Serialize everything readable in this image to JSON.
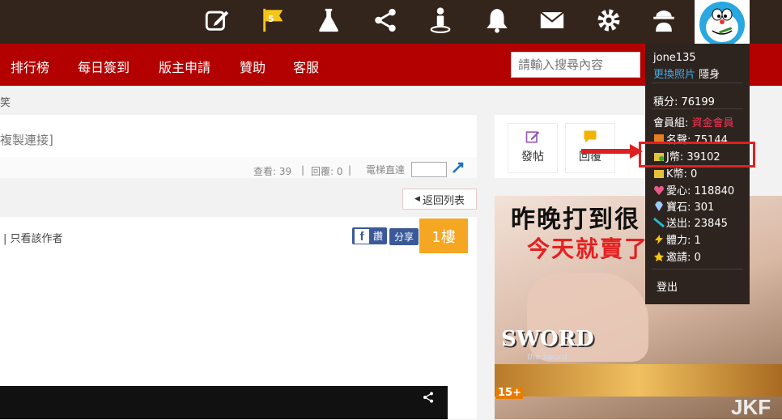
{
  "topbar": {
    "flag_count": "5",
    "icons": [
      "edit-icon",
      "flag-icon",
      "flask-icon",
      "share-icon",
      "user-location-icon",
      "bell-icon",
      "mail-icon",
      "gear-icon",
      "spy-icon"
    ]
  },
  "nav": {
    "items": [
      "排行榜",
      "每日簽到",
      "版主申請",
      "贊助",
      "客服"
    ]
  },
  "search": {
    "placeholder": "請輸入搜尋內容"
  },
  "breadcrumb": "笑",
  "thread": {
    "copy_link": "複製連接]",
    "views_label": "查看: 39",
    "replies_label": "回覆: 0",
    "elevator_label": "電梯直達",
    "back_to_list": "返回列表",
    "only_author": "| 只看該作者",
    "like_btn": "讚",
    "share_btn": "分享",
    "floor": "1樓"
  },
  "right_buttons": {
    "post": "發帖",
    "reply": "回覆"
  },
  "user_menu": {
    "username": "jone135",
    "change_photo": "更換照片",
    "invisible": "隱身",
    "points": "積分: 76199",
    "group_label": "會員組:",
    "group_value": "資金會員",
    "fame": "名聲: 75144",
    "jcoin": "J幣: 39102",
    "kcoin": "K幣: 0",
    "love": "愛心: 118840",
    "gem": "寶石: 301",
    "sent": "送出: 23845",
    "stamina": "體力: 1",
    "invite": "邀請: 0",
    "logout": "登出"
  },
  "ad": {
    "headline1": "昨晚打到很",
    "headline2": "今天就賣了",
    "logo": "SWORD",
    "logo_sub": "the sword",
    "rating": "15+"
  },
  "watermark": "JKF",
  "colors": {
    "topbar": "#33241c",
    "nav": "#b30000",
    "floor": "#f5a623",
    "highlight": "#e02020"
  }
}
